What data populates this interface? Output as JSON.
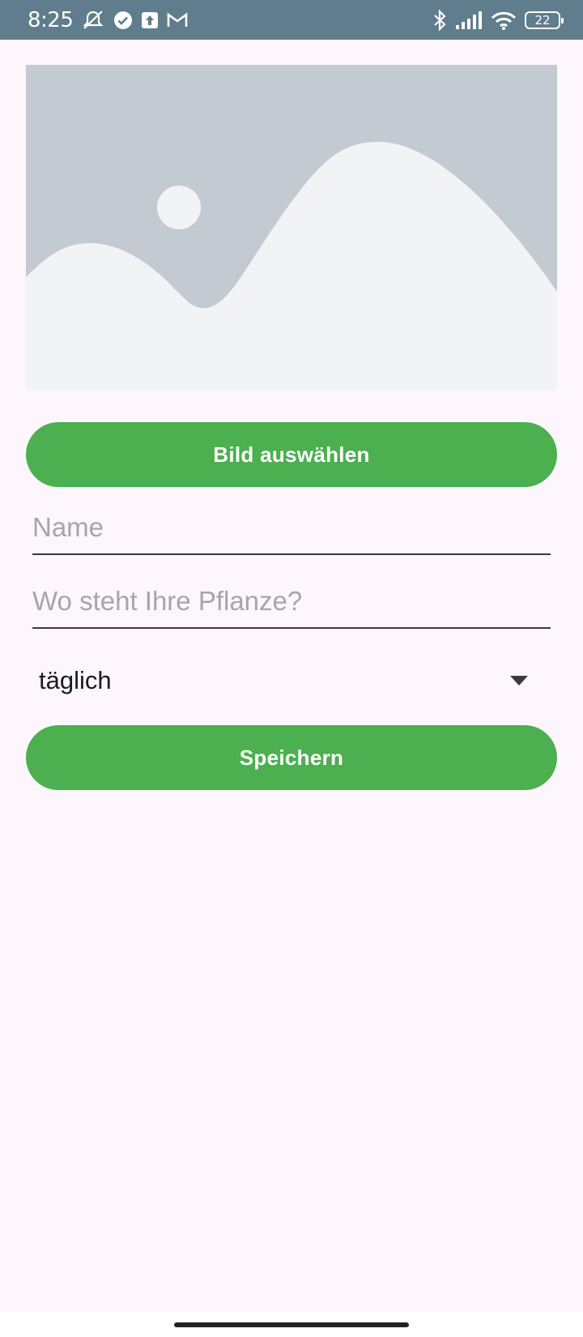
{
  "status_bar": {
    "time": "8:25",
    "battery": "22",
    "left_icons": [
      "alarm-off-icon",
      "check-circle-icon",
      "upload-icon",
      "gmail-icon"
    ],
    "right_icons": [
      "bluetooth-icon",
      "signal-icon",
      "wifi-icon",
      "battery-icon"
    ]
  },
  "image_placeholder": {
    "icon": "image-placeholder-icon",
    "background_color": "#C3CAD1",
    "shape_color": "#F1F3F4"
  },
  "buttons": {
    "select_image_label": "Bild auswählen",
    "save_label": "Speichern",
    "color": "#4CAF50"
  },
  "form": {
    "name_placeholder": "Name",
    "name_value": "",
    "location_placeholder": "Wo steht Ihre Pflanze?",
    "location_value": "",
    "frequency_selected": "täglich"
  },
  "colors": {
    "status_bar": "#5F7D8C",
    "background": "#FDF6FD"
  }
}
